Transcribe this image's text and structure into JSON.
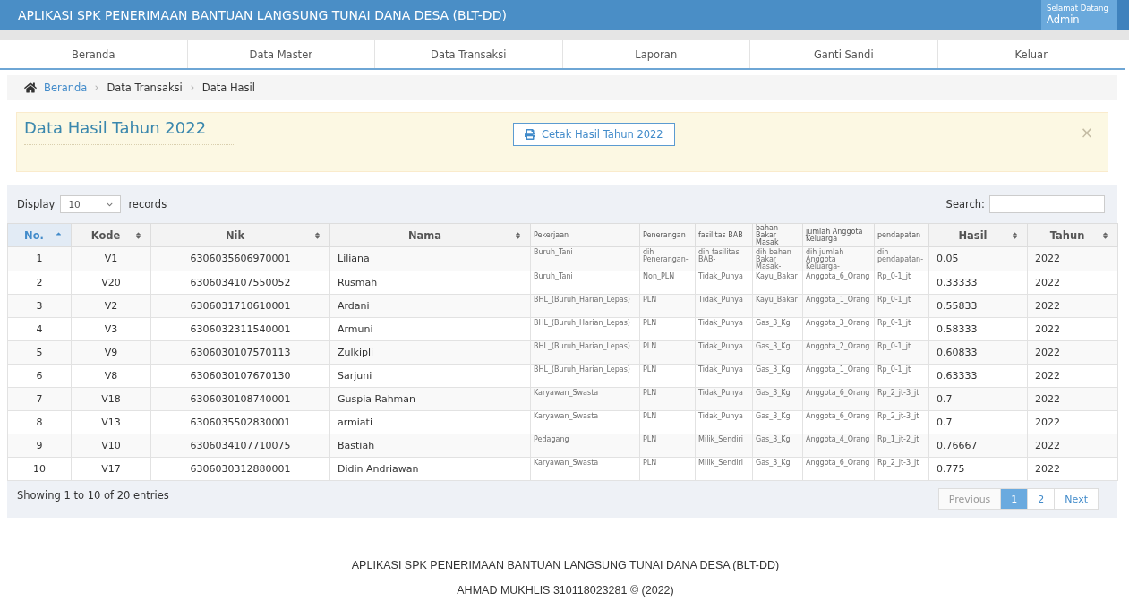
{
  "header": {
    "title": "APLIKASI SPK PENERIMAAN BANTUAN LANGSUNG TUNAI DANA DESA (BLT-DD)",
    "welcome": {
      "greeting": "Selamat Datang",
      "user": "Admin"
    }
  },
  "nav": [
    "Beranda",
    "Data Master",
    "Data Transaksi",
    "Laporan",
    "Ganti Sandi",
    "Keluar"
  ],
  "breadcrumb": [
    {
      "label": "Beranda",
      "kind": "link"
    },
    {
      "label": "Data Transaksi",
      "kind": "text"
    },
    {
      "label": "Data Hasil",
      "kind": "text"
    }
  ],
  "alert": {
    "title": "Data Hasil Tahun 2022",
    "button": "Cetak Hasil Tahun 2022",
    "close": "×"
  },
  "table_panel": {
    "length_label": "Display",
    "length_value": "10",
    "length_suffix": "records",
    "search_label": "Search:",
    "columns": [
      {
        "label": "No.",
        "kind": "centered",
        "sortable": true,
        "sorted": true
      },
      {
        "label": "Kode",
        "kind": "centered",
        "sortable": true,
        "sorted": false
      },
      {
        "label": "Nik",
        "kind": "centered",
        "sortable": true,
        "sorted": false
      },
      {
        "label": "Nama",
        "kind": "text",
        "sortable": true,
        "sorted": false
      },
      {
        "label": "Pekerjaan",
        "kind": "compact",
        "sortable": false,
        "sorted": false
      },
      {
        "label": "Penerangan",
        "kind": "compact",
        "sortable": false,
        "sorted": false
      },
      {
        "label": "fasilitas BAB",
        "kind": "compact",
        "sortable": false,
        "sorted": false
      },
      {
        "label": "bahan Bakar Masak",
        "kind": "compact",
        "sortable": false,
        "sorted": false
      },
      {
        "label": "jumlah Anggota Keluarga",
        "kind": "compact",
        "sortable": false,
        "sorted": false
      },
      {
        "label": "pendapatan",
        "kind": "compact",
        "sortable": false,
        "sorted": false
      },
      {
        "label": "Hasil",
        "kind": "text",
        "sortable": true,
        "sorted": false
      },
      {
        "label": "Tahun",
        "kind": "text",
        "sortable": true,
        "sorted": false
      }
    ],
    "rows": [
      [
        "1",
        "V1",
        "6306035606970001",
        "Liliana",
        "Buruh_Tani",
        "dih Penerangan-",
        "dih fasilitas BAB-",
        "dih bahan Bakar Masak-",
        "dih jumlah Anggota Keluarga-",
        "dih pendapatan-",
        "0.05",
        "2022"
      ],
      [
        "2",
        "V20",
        "6306034107550052",
        "Rusmah",
        "Buruh_Tani",
        "Non_PLN",
        "Tidak_Punya",
        "Kayu_Bakar",
        "Anggota_6_Orang",
        "Rp_0-1_jt",
        "0.33333",
        "2022"
      ],
      [
        "3",
        "V2",
        "6306031710610001",
        "Ardani",
        "BHL_(Buruh_Harian_Lepas)",
        "PLN",
        "Tidak_Punya",
        "Kayu_Bakar",
        "Anggota_1_Orang",
        "Rp_0-1_jt",
        "0.55833",
        "2022"
      ],
      [
        "4",
        "V3",
        "6306032311540001",
        "Armuni",
        "BHL_(Buruh_Harian_Lepas)",
        "PLN",
        "Tidak_Punya",
        "Gas_3_Kg",
        "Anggota_3_Orang",
        "Rp_0-1_jt",
        "0.58333",
        "2022"
      ],
      [
        "5",
        "V9",
        "6306030107570113",
        "Zulkipli",
        "BHL_(Buruh_Harian_Lepas)",
        "PLN",
        "Tidak_Punya",
        "Gas_3_Kg",
        "Anggota_2_Orang",
        "Rp_0-1_jt",
        "0.60833",
        "2022"
      ],
      [
        "6",
        "V8",
        "6306030107670130",
        "Sarjuni",
        "BHL_(Buruh_Harian_Lepas)",
        "PLN",
        "Tidak_Punya",
        "Gas_3_Kg",
        "Anggota_1_Orang",
        "Rp_0-1_jt",
        "0.63333",
        "2022"
      ],
      [
        "7",
        "V18",
        "6306030108740001",
        "Guspia Rahman",
        "Karyawan_Swasta",
        "PLN",
        "Tidak_Punya",
        "Gas_3_Kg",
        "Anggota_6_Orang",
        "Rp_2_jt-3_jt",
        "0.7",
        "2022"
      ],
      [
        "8",
        "V13",
        "6306035502830001",
        "armiati",
        "Karyawan_Swasta",
        "PLN",
        "Tidak_Punya",
        "Gas_3_Kg",
        "Anggota_6_Orang",
        "Rp_2_jt-3_jt",
        "0.7",
        "2022"
      ],
      [
        "9",
        "V10",
        "6306034107710075",
        "Bastiah",
        "Pedagang",
        "PLN",
        "Milik_Sendiri",
        "Gas_3_Kg",
        "Anggota_4_Orang",
        "Rp_1_jt-2_jt",
        "0.76667",
        "2022"
      ],
      [
        "10",
        "V17",
        "6306030312880001",
        "Didin Andriawan",
        "Karyawan_Swasta",
        "PLN",
        "Milik_Sendiri",
        "Gas_3_Kg",
        "Anggota_6_Orang",
        "Rp_2_jt-3_jt",
        "0.775",
        "2022"
      ]
    ],
    "info": "Showing 1 to 10 of 20 entries",
    "pagination": {
      "previous": {
        "label": "Previous",
        "disabled": true
      },
      "pages": [
        {
          "label": "1",
          "selected": true
        },
        {
          "label": "2",
          "selected": false
        }
      ],
      "next": {
        "label": "Next",
        "disabled": false
      }
    }
  },
  "footer": [
    "APLIKASI SPK PENERIMAAN BANTUAN LANGSUNG TUNAI DANA DESA (BLT-DD)",
    "AHMAD MUKHLIS 310118023281 © (2022)"
  ]
}
